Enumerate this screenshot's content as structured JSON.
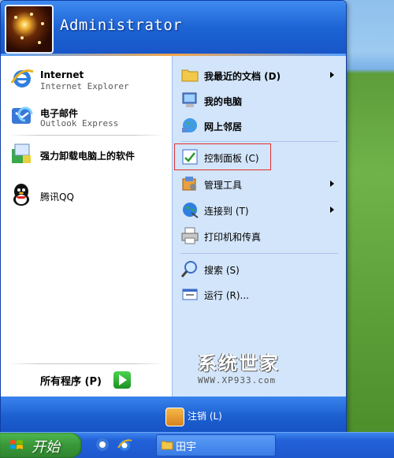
{
  "user": {
    "name": "Administrator"
  },
  "pinned": [
    {
      "title": "Internet",
      "subtitle": "Internet Explorer",
      "icon": "ie-icon"
    },
    {
      "title": "电子邮件",
      "subtitle": "Outlook Express",
      "icon": "outlook-icon"
    }
  ],
  "recent_programs": [
    {
      "title": "强力卸载电脑上的软件",
      "icon": "uninstall-icon"
    },
    {
      "title": "腾讯QQ",
      "icon": "qq-icon"
    }
  ],
  "all_programs_label": "所有程序 (P)",
  "right_items": [
    {
      "label": "我最近的文档 (D)",
      "icon": "recent-docs-icon",
      "submenu": true
    },
    {
      "label": "我的电脑",
      "icon": "my-computer-icon",
      "submenu": false
    },
    {
      "label": "网上邻居",
      "icon": "network-icon",
      "submenu": false
    },
    {
      "label": "控制面板 (C)",
      "icon": "control-panel-icon",
      "submenu": false,
      "highlighted": true
    },
    {
      "label": "管理工具",
      "icon": "admin-tools-icon",
      "submenu": true
    },
    {
      "label": "连接到 (T)",
      "icon": "connect-icon",
      "submenu": true
    },
    {
      "label": "打印机和传真",
      "icon": "printer-icon",
      "submenu": false
    },
    {
      "label": "搜索 (S)",
      "icon": "search-icon",
      "submenu": false
    },
    {
      "label": "运行 (R)...",
      "icon": "run-icon",
      "submenu": false
    }
  ],
  "logoff_label": "注销 (L)",
  "watermark": {
    "title": "系统世家",
    "url": "WWW.XP933.com"
  },
  "taskbar": {
    "start_label": "开始",
    "task_label": "田宇"
  },
  "colors": {
    "menu_header": "#1c63d4",
    "right_panel": "#d3e5fa",
    "start_button": "#3a9a3a",
    "highlight_border": "#e03030"
  }
}
